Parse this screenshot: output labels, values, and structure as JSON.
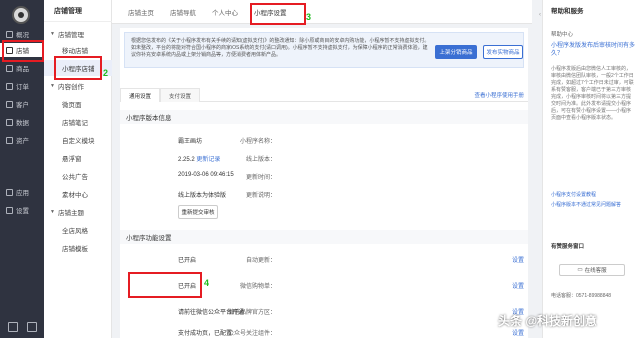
{
  "nav": {
    "items": [
      {
        "label": "概况",
        "icon": "overview-icon"
      },
      {
        "label": "店铺",
        "icon": "store-icon"
      },
      {
        "label": "商品",
        "icon": "goods-icon"
      },
      {
        "label": "订单",
        "icon": "order-icon"
      },
      {
        "label": "客户",
        "icon": "customer-icon"
      },
      {
        "label": "数据",
        "icon": "data-icon"
      },
      {
        "label": "资产",
        "icon": "asset-icon"
      },
      {
        "label": "应用",
        "icon": "apps-icon"
      },
      {
        "label": "设置",
        "icon": "settings-icon"
      }
    ]
  },
  "submenu": {
    "title": "店铺管理",
    "items": [
      {
        "label": "店铺管理",
        "type": "group"
      },
      {
        "label": "移动店铺",
        "type": "leaf"
      },
      {
        "label": "小程序店铺",
        "type": "leaf"
      },
      {
        "label": "内容创作",
        "type": "group"
      },
      {
        "label": "微页面",
        "type": "leaf"
      },
      {
        "label": "店铺笔记",
        "type": "leaf"
      },
      {
        "label": "自定义模块",
        "type": "leaf"
      },
      {
        "label": "悬浮窗",
        "type": "leaf"
      },
      {
        "label": "公共广告",
        "type": "leaf"
      },
      {
        "label": "素材中心",
        "type": "leaf"
      },
      {
        "label": "店铺主题",
        "type": "group"
      },
      {
        "label": "全店风格",
        "type": "leaf"
      },
      {
        "label": "店铺模板",
        "type": "leaf"
      }
    ]
  },
  "tabs": [
    "店铺主页",
    "店铺导航",
    "个人中心",
    "小程序设置"
  ],
  "annotations": [
    "1",
    "2",
    "3",
    "4"
  ],
  "notice": {
    "text": "根据您信发布的《关于小程序发布有关手续的请知(虚拟支付)》的整改通知：除小原或商目的安卓内购功能，小程序暂不支持虚拟支付。如未整改，平台的将能对符合国小程序的商家iOS系统的支付(请口调用)。小程序暂不支持虚拟支付，为保障小程序的正常消费体验，建议你补充安卓系统内品或上架分销商品等，方便消费者用体新产品。",
    "btn_primary": "上架分销商品",
    "btn_secondary": "发布实物商品"
  },
  "subtabs": [
    "通用设置",
    "支付设置"
  ],
  "subtab_link": "查看小程序使用手册",
  "version": {
    "title": "小程序版本信息",
    "rows": [
      {
        "k": "小程序名称：",
        "v": "霸王画坊"
      },
      {
        "k": "线上版本：",
        "v": "2.25.2",
        "link": "更新记录"
      },
      {
        "k": "更新时间：",
        "v": "2019-03-06 09:46:15"
      },
      {
        "k": "更新说明：",
        "v": "线上版本为体验版"
      }
    ],
    "button": "重新提交审核"
  },
  "features": {
    "title": "小程序功能设置",
    "rows": [
      {
        "k": "自动更新：",
        "v": "已开启",
        "link": "设置"
      },
      {
        "k": "微信购物单：",
        "v": "已开启",
        "link": "设置"
      },
      {
        "k": "微信品牌官方区：",
        "v": "请前往微信公众平台开通",
        "link": "设置"
      },
      {
        "k": "公众号关注组件：",
        "v": "支付成功页，已配置",
        "link": "设置"
      }
    ]
  },
  "help": {
    "title": "帮助和服务",
    "section": "帮助中心",
    "question": "小程序发版发布后审核时间有多久？",
    "answer": "小程序发版后由您微信人工审核的，审核由微信团队审核，一般2个工作日完成，如超过7个工作日未过审，可联系有赞客服，客户端已于第三方审核完成，小程序审核时间将以第三方提交时间为准。此外发布请提交小程序后，可在有赞小程序设置——小程序页面中查看小程序版本状态。",
    "links": [
      "小程序支付设置教程",
      "小程序版本不通过常见问题解答"
    ],
    "service_title": "有赞服务窗口",
    "service_btn": "在线客服",
    "phone": "电话客服：0571-89988848"
  },
  "watermark": "头条 @科技新创意"
}
